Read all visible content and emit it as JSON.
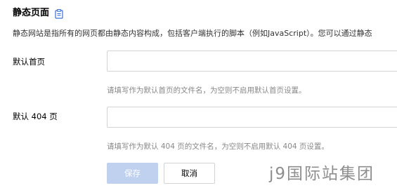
{
  "section": {
    "title": "静态页面",
    "doc_icon": "document-icon",
    "description": "静态网站是指所有的网页都由静态内容构成，包括客户端执行的脚本（例如JavaScript）。您可以通过静态"
  },
  "form": {
    "index_page": {
      "label": "默认首页",
      "value": "",
      "placeholder": "",
      "hint": "请填写作为默认首页的文件名，为空则不启用默认首页设置。"
    },
    "error_page": {
      "label": "默认 404 页",
      "value": "",
      "placeholder": "",
      "hint": "请填写作为默认 404 页的文件名，为空则不启用默认 404 页设置。"
    }
  },
  "actions": {
    "save_label": "保存",
    "cancel_label": "取消"
  },
  "watermark": "j9国际站集团",
  "colors": {
    "save_disabled_bg": "#bfd1ef",
    "doc_icon": "#3b6fd8",
    "input_border": "#d3d3d3",
    "hint_text": "#888888"
  }
}
